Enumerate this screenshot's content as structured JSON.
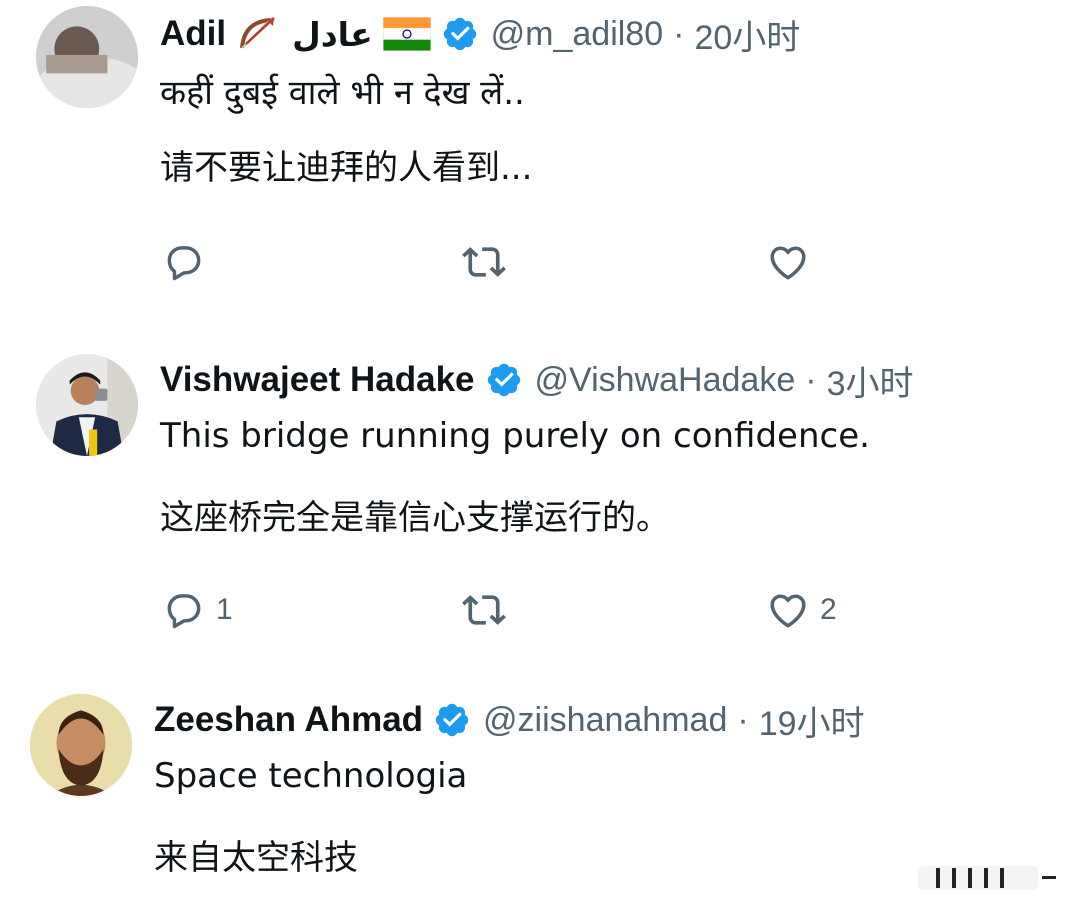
{
  "tweets": [
    {
      "name": "Adil",
      "name_urdu": "عادل",
      "handle": "@m_adil80",
      "separator": "·",
      "time": "20小时",
      "lines": [
        "कहीं दुबई वाले भी न देख लें..",
        "请不要让迪拜的人看到..."
      ],
      "reply_count": "",
      "retweet_count": "",
      "like_count": ""
    },
    {
      "name": "Vishwajeet Hadake",
      "handle": "@VishwaHadake",
      "separator": "·",
      "time": "3小时",
      "lines": [
        "This bridge running purely on confidence.",
        "这座桥完全是靠信心支撑运行的。"
      ],
      "reply_count": "1",
      "retweet_count": "",
      "like_count": "2"
    },
    {
      "name": "Zeeshan Ahmad",
      "handle": "@ziishanahmad",
      "separator": "·",
      "time": "19小时",
      "lines": [
        "Space technologia",
        "来自太空科技"
      ]
    }
  ],
  "colors": {
    "verified": "#1d9bf0",
    "muted": "#536471",
    "text": "#0f1419"
  },
  "icons": [
    "reply-icon",
    "retweet-icon",
    "like-icon",
    "verified-badge-icon",
    "bow-arrow-icon",
    "india-flag-icon"
  ]
}
